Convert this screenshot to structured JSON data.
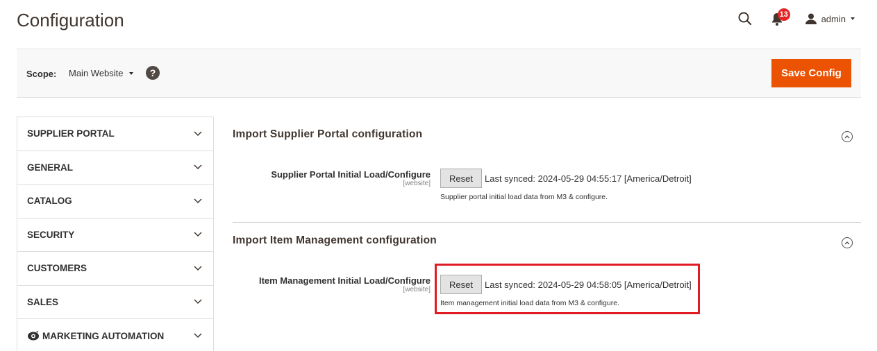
{
  "page": {
    "title": "Configuration"
  },
  "header": {
    "notifications_count": "13",
    "user_name": "admin"
  },
  "scope": {
    "label": "Scope:",
    "value": "Main Website",
    "help": "?",
    "save_label": "Save Config"
  },
  "sidebar": {
    "items": [
      {
        "label": "SUPPLIER PORTAL"
      },
      {
        "label": "GENERAL"
      },
      {
        "label": "CATALOG"
      },
      {
        "label": "SECURITY"
      },
      {
        "label": "CUSTOMERS"
      },
      {
        "label": "SALES"
      },
      {
        "label": "MARKETING AUTOMATION",
        "icon": "marketing-automation-icon"
      }
    ]
  },
  "sections": [
    {
      "title": "Import Supplier Portal configuration",
      "row": {
        "label": "Supplier Portal Initial Load/Configure",
        "scope": "[website]",
        "button": "Reset",
        "synced": "Last synced: 2024-05-29 04:55:17 [America/Detroit]",
        "note": "Supplier portal initial load data from M3 & configure."
      }
    },
    {
      "title": "Import Item Management configuration",
      "row": {
        "label": "Item Management Initial Load/Configure",
        "scope": "[website]",
        "button": "Reset",
        "synced": "Last synced: 2024-05-29 04:58:05 [America/Detroit]",
        "note": "Item management initial load data from M3 & configure."
      }
    }
  ],
  "colors": {
    "accent": "#eb5202",
    "highlight": "#e01b24",
    "badge": "#e22626"
  }
}
